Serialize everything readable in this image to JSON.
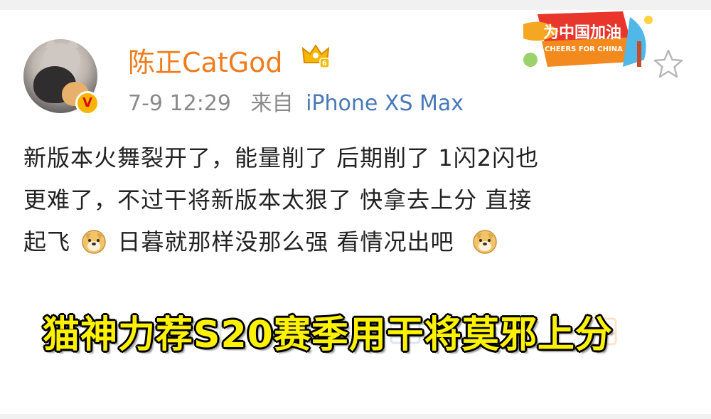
{
  "post": {
    "username": "陈正CatGod",
    "time": "7-9 12:29",
    "source_label": "来自",
    "device": "iPhone XS Max",
    "text_lines": {
      "line1": "新版本火舞裂开了，能量削了 后期削了 1闪2闪也",
      "line2": "更难了，不过干将新版本太狠了 快拿去上分 直接",
      "line3_a": "起飞",
      "line3_b": "日暮就那样没那么强 看情况出吧"
    },
    "icons": {
      "avatar": "cat-avatar",
      "verified": "verified-v-badge",
      "member_crown": "crown-icon",
      "emoji": "doge-icon",
      "favorite": "star-icon"
    }
  },
  "badge": {
    "title": "为中国加油",
    "subtitle": "CHEERS FOR CHINA"
  },
  "caption": "猫神力荐S20赛季用干将莫邪上分",
  "colors": {
    "username": "#f07c1e",
    "device": "#4a78b8",
    "meta": "#8a8a8a",
    "caption": "#fff200",
    "badge_red": "#e8362c",
    "verified": "#f7b500"
  }
}
